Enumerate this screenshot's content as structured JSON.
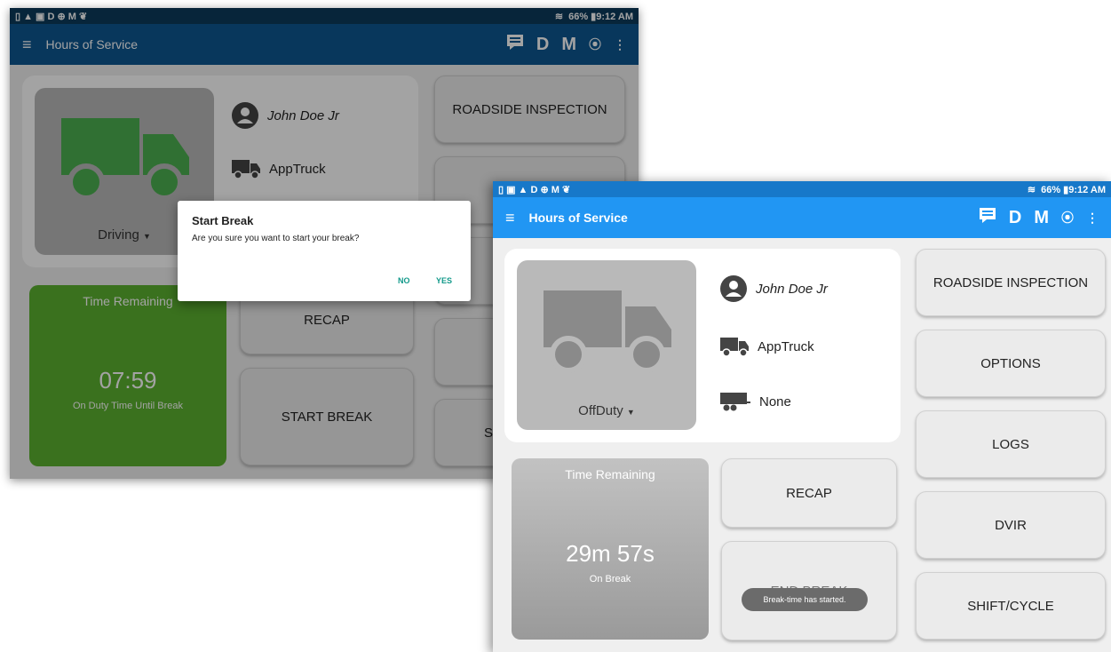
{
  "screen1": {
    "statusbar": {
      "left_icons": "▯ ▲ ▣ D ⊕ M ❦",
      "right": "66% ▮9:12 AM"
    },
    "appbar": {
      "title": "Hours of Service",
      "icons": [
        "message-icon",
        "D",
        "M",
        "broadcast-icon",
        "overflow-icon"
      ]
    },
    "driver_name": "John Doe Jr",
    "vehicle": "AppTruck",
    "status": "Driving",
    "buttons": {
      "roadside": "ROADSIDE INSPECTION",
      "recap": "RECAP",
      "start_break": "START BREAK",
      "partial": "S"
    },
    "time": {
      "label": "Time Remaining",
      "value": "07:59",
      "sub": "On Duty Time Until Break"
    },
    "dialog": {
      "title": "Start Break",
      "message": "Are you sure you want to start your break?",
      "no": "NO",
      "yes": "YES"
    }
  },
  "screen2": {
    "statusbar": {
      "left_icons": "▯ ▣ ▲ D ⊕ M ❦",
      "right": "66% ▮9:12 AM"
    },
    "appbar": {
      "title": "Hours of Service",
      "d": "D",
      "m": "M"
    },
    "driver_name": "John Doe Jr",
    "vehicle": "AppTruck",
    "trailer": "None",
    "status": "OffDuty",
    "buttons": {
      "roadside": "ROADSIDE INSPECTION",
      "options": "OPTIONS",
      "logs": "LOGS",
      "dvir": "DVIR",
      "shift_cycle": "SHIFT/CYCLE",
      "recap": "RECAP",
      "end_break": "END BREAK"
    },
    "time": {
      "label": "Time Remaining",
      "value": "29m 57s",
      "sub": "On Break"
    },
    "toast": "Break-time has started."
  },
  "colors": {
    "green_truck": "#4caf50",
    "gray_truck": "#8a8a8a",
    "appbar_blue": "#2196f3",
    "time_green": "#5bb12f",
    "dialog_accent": "#12998a"
  }
}
